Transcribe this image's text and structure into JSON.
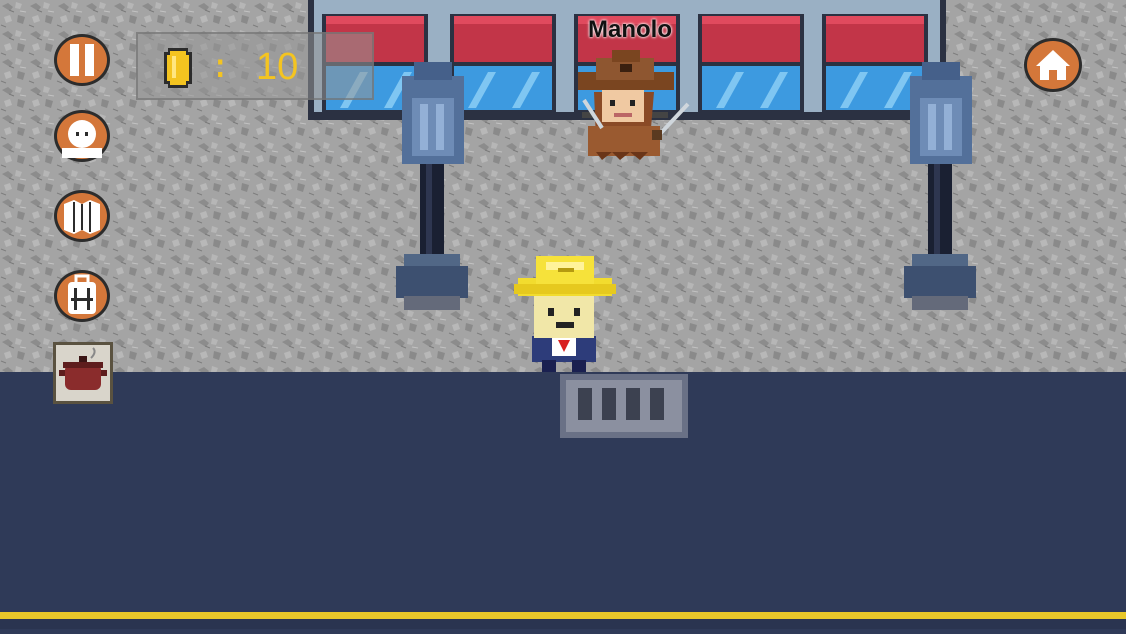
{
  "hud": {
    "coin_separator": ":",
    "coin_count": "10",
    "buttons": [
      "pause-icon",
      "character-face-icon",
      "map-icon",
      "backpack-icon",
      "cooking-pot-icon",
      "home-icon"
    ]
  },
  "npc": {
    "name": "Manolo"
  },
  "colors": {
    "sidewalk": "#9a9a9a",
    "road": "#2f3a58",
    "road_line": "#e8c72a",
    "button_orange": "#d4773a",
    "coin_text": "#f4c420"
  }
}
